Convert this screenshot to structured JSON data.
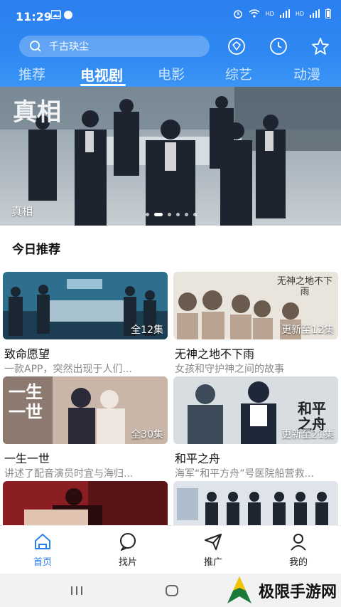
{
  "status": {
    "time": "11:29",
    "net1": "HD",
    "net2": "HD",
    "signal": "4G"
  },
  "search": {
    "placeholder": "千古玦尘"
  },
  "tabs": [
    {
      "label": "推荐"
    },
    {
      "label": "电视剧"
    },
    {
      "label": "电影"
    },
    {
      "label": "综艺"
    },
    {
      "label": "动漫"
    }
  ],
  "banner": {
    "caption": "真相",
    "title_art": "真相",
    "dots": 6,
    "active_dot": 1
  },
  "section": {
    "title": "今日推荐"
  },
  "cards": [
    {
      "title": "致命愿望",
      "desc": "一款APP，突然出现于人们...",
      "episodes": "全12集"
    },
    {
      "title": "无神之地不下雨",
      "desc": "女孩和守护神之间的故事",
      "episodes": "更新至12集",
      "poster_text": "无神之地不下雨"
    },
    {
      "title": "一生一世",
      "desc": "讲述了配音演员时宜与海归...",
      "episodes": "全30集",
      "poster_text": "一生一世"
    },
    {
      "title": "和平之舟",
      "desc": "海军“和平方舟”号医院船营救...",
      "episodes": "更新至21集",
      "poster_text": "和平之舟"
    },
    {
      "title": "",
      "desc": "",
      "episodes": ""
    },
    {
      "title": "",
      "desc": "",
      "episodes": ""
    }
  ],
  "bottomnav": [
    {
      "label": "首页",
      "icon": "home-icon"
    },
    {
      "label": "找片",
      "icon": "chat-search-icon"
    },
    {
      "label": "推广",
      "icon": "paper-plane-icon"
    },
    {
      "label": "我的",
      "icon": "user-icon"
    }
  ],
  "watermark": {
    "text": "极限手游网"
  },
  "colors": {
    "brand": "#2b7ff0",
    "muted": "#888888"
  }
}
